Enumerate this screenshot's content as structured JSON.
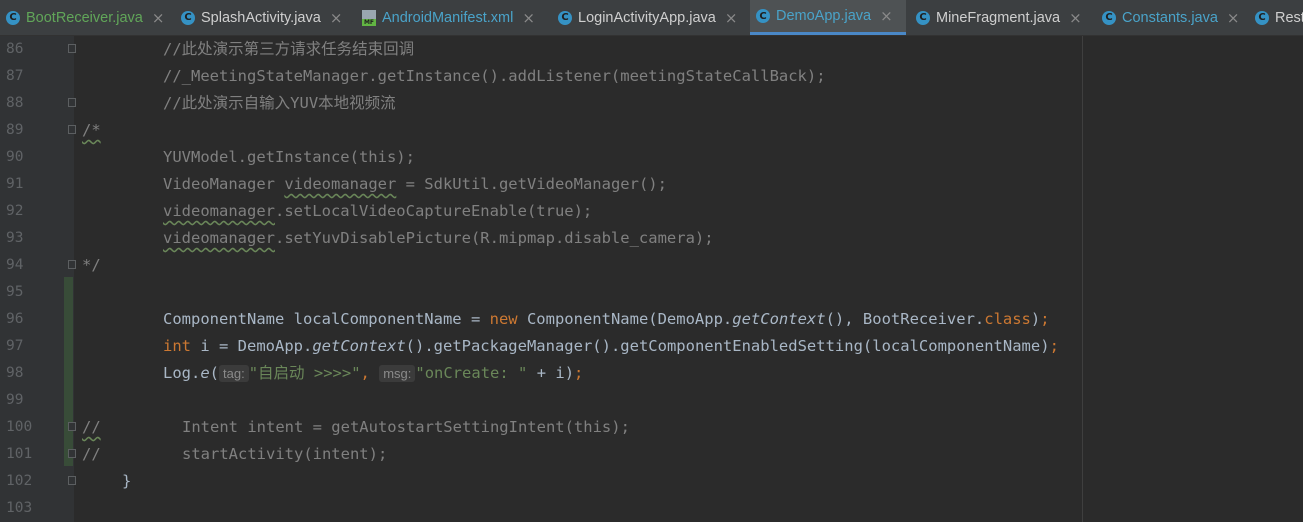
{
  "tabs": [
    {
      "name": "BootReceiver.java",
      "icon": "class-icon",
      "color": "green",
      "active": false
    },
    {
      "name": "SplashActivity.java",
      "icon": "class-icon",
      "color": "plain",
      "active": false
    },
    {
      "name": "AndroidManifest.xml",
      "icon": "manifest-icon",
      "color": "blue",
      "active": false
    },
    {
      "name": "LoginActivityApp.java",
      "icon": "class-icon",
      "color": "plain",
      "active": false
    },
    {
      "name": "DemoApp.java",
      "icon": "class-icon",
      "color": "blue",
      "active": true
    },
    {
      "name": "MineFragment.java",
      "icon": "class-icon",
      "color": "plain",
      "active": false
    },
    {
      "name": "Constants.java",
      "icon": "class-icon",
      "color": "blue",
      "active": false
    },
    {
      "name": "Rest",
      "icon": "class-icon",
      "color": "plain",
      "active": false
    }
  ],
  "close_glyph": "×",
  "icon_letter": "C",
  "manifest_label": "MF",
  "lines": [
    {
      "n": "86",
      "gutter": "",
      "code": "//此处演示第三方请求任务结束回调"
    },
    {
      "n": "87",
      "gutter": "",
      "code": "//_MeetingStateManager.getInstance().addListener(meetingStateCallBack);"
    },
    {
      "n": "88",
      "gutter": "",
      "code": "//此处演示自输入YUV本地视频流"
    },
    {
      "n": "89",
      "gutter": "/*",
      "code": ""
    },
    {
      "n": "90",
      "gutter": "",
      "code": "YUVModel.getInstance(this);"
    },
    {
      "n": "91",
      "gutter": "",
      "code": "VideoManager videomanager = SdkUtil.getVideoManager();"
    },
    {
      "n": "92",
      "gutter": "",
      "code": "videomanager.setLocalVideoCaptureEnable(true);"
    },
    {
      "n": "93",
      "gutter": "",
      "code": "videomanager.setYuvDisablePicture(R.mipmap.disable_camera);"
    },
    {
      "n": "94",
      "gutter": "*/",
      "code": ""
    },
    {
      "n": "95",
      "gutter": "",
      "code": ""
    },
    {
      "n": "96",
      "gutter": "",
      "code": "ComponentName localComponentName = new ComponentName(DemoApp.getContext(), BootReceiver.class);"
    },
    {
      "n": "97",
      "gutter": "",
      "code": "int i = DemoApp.getContext().getPackageManager().getComponentEnabledSetting(localComponentName);"
    },
    {
      "n": "98",
      "gutter": "",
      "code": "Log.e(tag: \"自启动 >>>>\", msg: \"onCreate: \" + i);"
    },
    {
      "n": "99",
      "gutter": "",
      "code": ""
    },
    {
      "n": "100",
      "gutter": "//",
      "code": "Intent intent = getAutostartSettingIntent(this);"
    },
    {
      "n": "101",
      "gutter": "//",
      "code": "startActivity(intent);"
    },
    {
      "n": "102",
      "gutter": "",
      "code": "}"
    },
    {
      "n": "103",
      "gutter": "",
      "code": ""
    }
  ],
  "tokens": {
    "l96": {
      "a": "ComponentName localComponentName = ",
      "kw_new": "new",
      "b": " ComponentName(DemoApp.",
      "it": "getContext",
      "c": "(), BootReceiver.",
      "kw_class": "class",
      "d": ")",
      "semi": ";"
    },
    "l97": {
      "kw_int": "int",
      "a": " i = DemoApp.",
      "it": "getContext",
      "b": "().getPackageManager().getComponentEnabledSetting(localComponentName)",
      "semi": ";"
    },
    "l98": {
      "a": "Log.",
      "it": "e",
      "b": "(",
      "hint_tag": "tag:",
      "str1": "\"自启动 >>>>\"",
      "comma": ",",
      "hint_msg": "msg:",
      "str2": "\"onCreate: \"",
      "c": " + i)",
      "semi": ";"
    },
    "l91": {
      "a": "VideoManager ",
      "var": "videomanager",
      "b": " = SdkUtil.getVideoManager();"
    },
    "l92": {
      "var": "videomanager",
      "b": ".setLocalVideoCaptureEnable(true);"
    },
    "l93": {
      "var": "videomanager",
      "b": ".setYuvDisablePicture(R.mipmap.disable_camera);"
    }
  }
}
